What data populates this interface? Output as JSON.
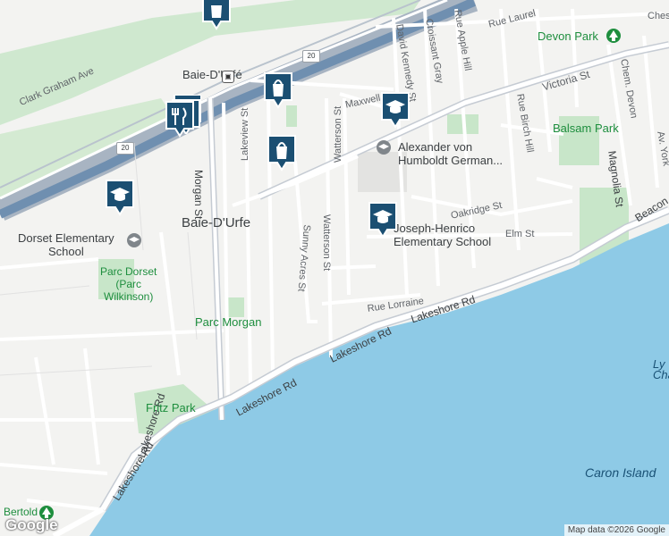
{
  "places": {
    "town_name": "Baie-D'Urfe",
    "station_name": "Baie-D'Urfé"
  },
  "roads": {
    "clark_graham": "Clark Graham Ave",
    "maxwell": "Maxwell St",
    "victoria": "Victoria St",
    "rue_laurel": "Rue Laurel",
    "chest": "Ches",
    "lakeview": "Lakeview St",
    "morgan": "Morgan St",
    "watterson_top": "Watterson St",
    "watterson_bottom": "Watterson St",
    "sunny_acres": "Sunny Acres St",
    "david_kennedy": "David Kennedy St",
    "croissant_gray": "Croissant Gray",
    "rue_apple_hill": "Rue Apple Hill",
    "rue_birch_hill": "Rue Birch Hill",
    "chem_devon": "Chem. Devon",
    "magnolia": "Magnolia St",
    "av_york": "Av. York",
    "oakridge": "Oakridge St",
    "elm": "Elm St",
    "rue_lorraine": "Rue Lorraine",
    "lakeshore_1": "Lakeshore Rd",
    "lakeshore_2": "Lakeshore Rd",
    "lakeshore_3": "Lakeshore Rd",
    "lakeshore_4": "Lakeshore Rd",
    "lakeshore_5": "Lakeshore Rd",
    "beaconsfield": "Beacon",
    "highway_shield_1": "20",
    "highway_shield_2": "20"
  },
  "parks": {
    "devon_park": "Devon Park",
    "balsam_park": "Balsam Park",
    "parc_dorset": "Parc Dorset\n(Parc\nWilkinson)",
    "parc_morgan": "Parc Morgan",
    "fritz_park": "Fritz Park",
    "bertold": "Bertold"
  },
  "schools": {
    "alexander": "Alexander von\nHumboldt German...",
    "joseph": "Joseph-Henrico\nElementary School",
    "dorset": "Dorset Elementary\nSchool"
  },
  "water": {
    "caron_island": "Caron Island",
    "ly_cha": "Ly\nCha"
  },
  "footer": {
    "google_logo": "Google",
    "attribution": "Map data ©2026 Google"
  },
  "colors": {
    "land": "#f3f3f1",
    "park": "#c8e6c9",
    "water": "#8ecae6",
    "highway": "#6f8fb0",
    "marker": "#1b4f72"
  }
}
